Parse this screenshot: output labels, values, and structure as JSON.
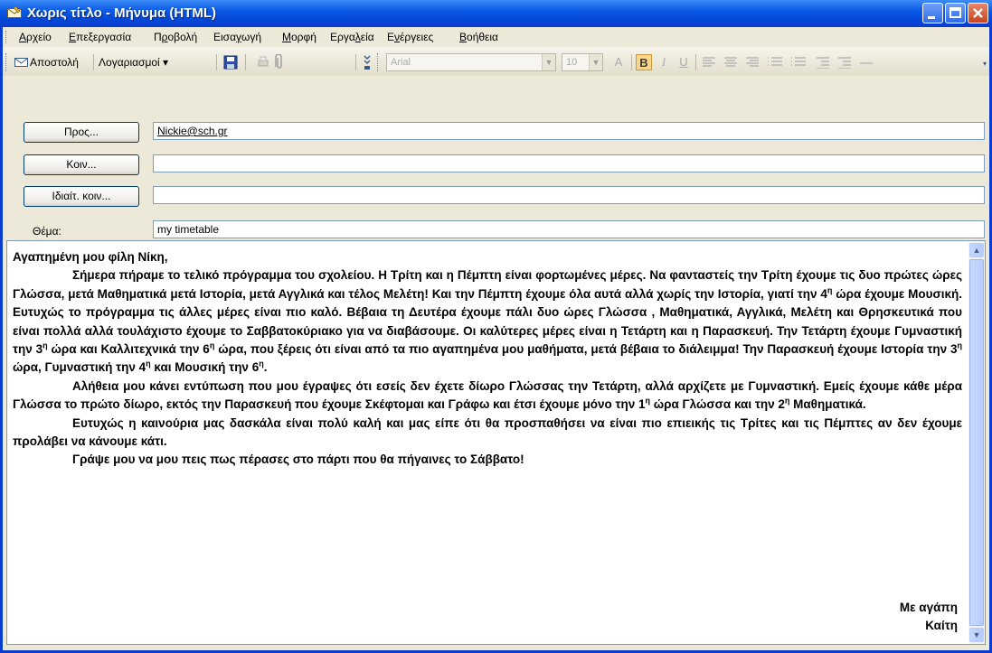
{
  "window": {
    "title": "Χωρις τίτλο - Μήνυμα (HTML)"
  },
  "menu": [
    {
      "pre": "",
      "u": "Α",
      "post": "ρχείο"
    },
    {
      "pre": "",
      "u": "Ε",
      "post": "πεξεργασία"
    },
    {
      "pre": "Π",
      "u": "ρ",
      "post": "οβολή"
    },
    {
      "pre": "Εισα",
      "u": "γ",
      "post": "ωγή"
    },
    {
      "pre": "",
      "u": "Μ",
      "post": "ορφή"
    },
    {
      "pre": "Εργα",
      "u": "λ",
      "post": "εία"
    },
    {
      "pre": "Ε",
      "u": "ν",
      "post": "έργειες"
    },
    {
      "pre": "",
      "u": "Β",
      "post": "οήθεια"
    }
  ],
  "toolbar": {
    "send_label": "Αποστολή",
    "accounts_label": "Λογαριασμοί ▾",
    "font_name": "Arial",
    "font_size": "10"
  },
  "header": {
    "to_label": "Προς...",
    "cc_label": "Κοιν...",
    "bcc_label": "Ιδιαίτ. κοιν...",
    "subject_label": "Θέμα:",
    "to_value": "Nickie@sch.gr",
    "cc_value": "",
    "bcc_value": "",
    "subject_value": "my timetable"
  },
  "message": {
    "greeting": "Αγαπημένη μου φίλη Νίκη,",
    "p1_a": "Σήμερα πήραμε το τελικό πρόγραμμα του σχολείου. Η Τρίτη και η Πέμπτη είναι φορτωμένες μέρες. Να φανταστείς την Τρίτη έχουμε τις δυο πρώτες ώρες Γλώσσα, μετά Μαθηματικά μετά Ιστορία, μετά Αγγλικά και τέλος Μελέτη! Και την Πέμπτη έχουμε όλα αυτά αλλά χωρίς την Ιστορία, γιατί την 4",
    "p1_b": " ώρα έχουμε Μουσική. Ευτυχώς το πρόγραμμα τις άλλες μέρες είναι πιο καλό. Βέβαια τη Δευτέρα έχουμε πάλι δυο ώρες Γλώσσα , Μαθηματικά, Αγγλικά, Μελέτη και Θρησκευτικά που είναι πολλά αλλά τουλάχιστο έχουμε το Σαββατοκύριακο για να διαβάσουμε. Οι καλύτερες μέρες είναι η Τετάρτη και η Παρασκευή. Την Τετάρτη έχουμε Γυμναστική την 3",
    "p1_c": " ώρα και Καλλιτεχνικά την 6",
    "p1_d": " ώρα, που ξέρεις ότι είναι από τα πιο αγαπημένα μου μαθήματα, μετά βέβαια το διάλειμμα! Την Παρασκευή έχουμε Ιστορία την 3",
    "p1_e": " ώρα, Γυμναστική την 4",
    "p1_f": " και Μουσική την 6",
    "p1_g": ".",
    "p2_a": "Αλήθεια μου κάνει εντύπωση που μου έγραψες ότι εσείς δεν έχετε δίωρο Γλώσσας την Τετάρτη, αλλά αρχίζετε με Γυμναστική. Εμείς έχουμε κάθε μέρα Γλώσσα το πρώτο δίωρο, εκτός την Παρασκευή που έχουμε Σκέφτομαι και Γράφω και έτσι έχουμε μόνο την 1",
    "p2_b": " ώρα Γλώσσα και την 2",
    "p2_c": " Μαθηματικά.",
    "p3": "Ευτυχώς η καινούρια μας δασκάλα είναι πολύ καλή και μας είπε ότι θα προσπαθήσει να είναι πιο επιεικής τις Τρίτες και τις Πέμπτες αν δεν έχουμε προλάβει να κάνουμε κάτι.",
    "p4": "Γράψε μου να μου πεις πως πέρασες στο πάρτι που θα πήγαινες το Σάββατο!",
    "ordinal": "η",
    "sign1": "Με αγάπη",
    "sign2": "Καίτη"
  }
}
